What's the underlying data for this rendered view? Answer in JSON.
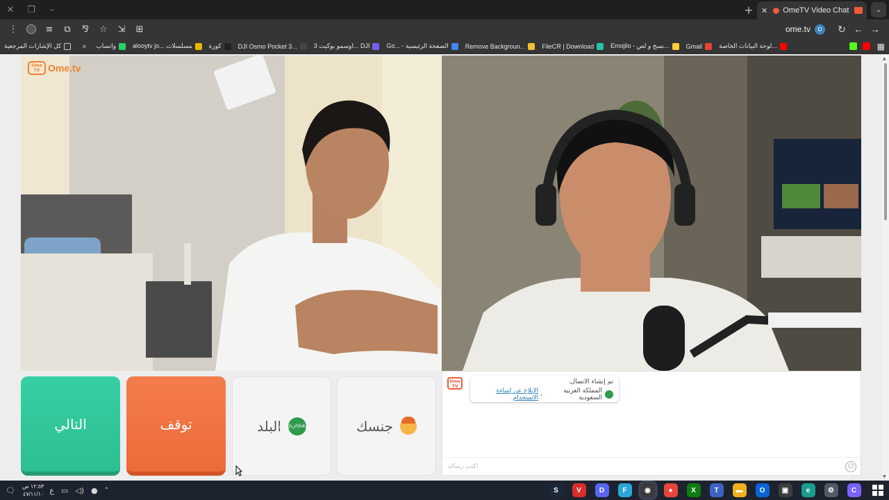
{
  "browser": {
    "tab_title": "OmeTV Video Chat — Ome",
    "url": "ome.tv",
    "site_badge": "D"
  },
  "bookmarks": {
    "all_bookmarks": "كل الإشارات المرجعية",
    "items": [
      {
        "label": "واتساب",
        "color": "#25d366"
      },
      {
        "label": "alooytv jo... مسلسلات",
        "color": "#e6b800"
      },
      {
        "label": "كورة",
        "color": "#222222"
      },
      {
        "label": "DJI Osmo Pocket 3...",
        "color": "#444444"
      },
      {
        "label": "اوسمو بوكيت 3... DJI",
        "color": "#7b5cf0"
      },
      {
        "label": "Go... - الصفحة الرئيسية",
        "color": "#4285f4"
      },
      {
        "label": "Remove Backgroun...",
        "color": "#f2c12e"
      },
      {
        "label": "FileCR | Download",
        "color": "#23c4a8"
      },
      {
        "label": "Emojilo - نسخ و لص...",
        "color": "#ffcc33"
      },
      {
        "label": "Gmail",
        "color": "#ea4335"
      },
      {
        "label": "لوحة البيانات الخاصة...",
        "color": "#ff0000"
      }
    ],
    "end_icons": [
      {
        "name": "kick",
        "color": "#53fc18"
      },
      {
        "name": "youtube",
        "color": "#ff0000"
      }
    ]
  },
  "site": {
    "logo_mark": "Ome TV",
    "logo_text": "Ome.tv"
  },
  "controls": {
    "next": "التالي",
    "stop": "توقف",
    "country": "البلد",
    "gender": "جنسك"
  },
  "chat": {
    "avatar_text": "Ome TV",
    "connected": "تم إنشاء الاتصال.",
    "country_text": "المملكة العربية السعودية",
    "report_link": "الإبلاغ عن إساءة الاستخدام",
    "placeholder": "اكتب رسالة"
  },
  "taskbar": {
    "time": "١٢:٥٣ ص",
    "date": "٤٧/١١/١٠",
    "lang": "ع",
    "apps": [
      {
        "name": "steam",
        "color": "#1b2838",
        "glyph": "S"
      },
      {
        "name": "vivaldi",
        "color": "#d92d2d",
        "glyph": "V"
      },
      {
        "name": "discord",
        "color": "#5865f2",
        "glyph": "D"
      },
      {
        "name": "filecr",
        "color": "#2aa6d9",
        "glyph": "F"
      },
      {
        "name": "obs",
        "color": "#3a3a3a",
        "glyph": "◉"
      },
      {
        "name": "chrome",
        "color": "#e8453c",
        "glyph": "●"
      },
      {
        "name": "xbox",
        "color": "#107c10",
        "glyph": "X"
      },
      {
        "name": "teams",
        "color": "#3c63c4",
        "glyph": "T"
      },
      {
        "name": "explorer",
        "color": "#f2b01e",
        "glyph": "▬"
      },
      {
        "name": "outlook",
        "color": "#0a64d6",
        "glyph": "O"
      },
      {
        "name": "store",
        "color": "#3d3d3d",
        "glyph": "▣"
      },
      {
        "name": "edge",
        "color": "#1a9d8f",
        "glyph": "e"
      },
      {
        "name": "settings",
        "color": "#555b66",
        "glyph": "⚙"
      },
      {
        "name": "copilot",
        "color": "#7b61ff",
        "glyph": "C"
      }
    ]
  }
}
